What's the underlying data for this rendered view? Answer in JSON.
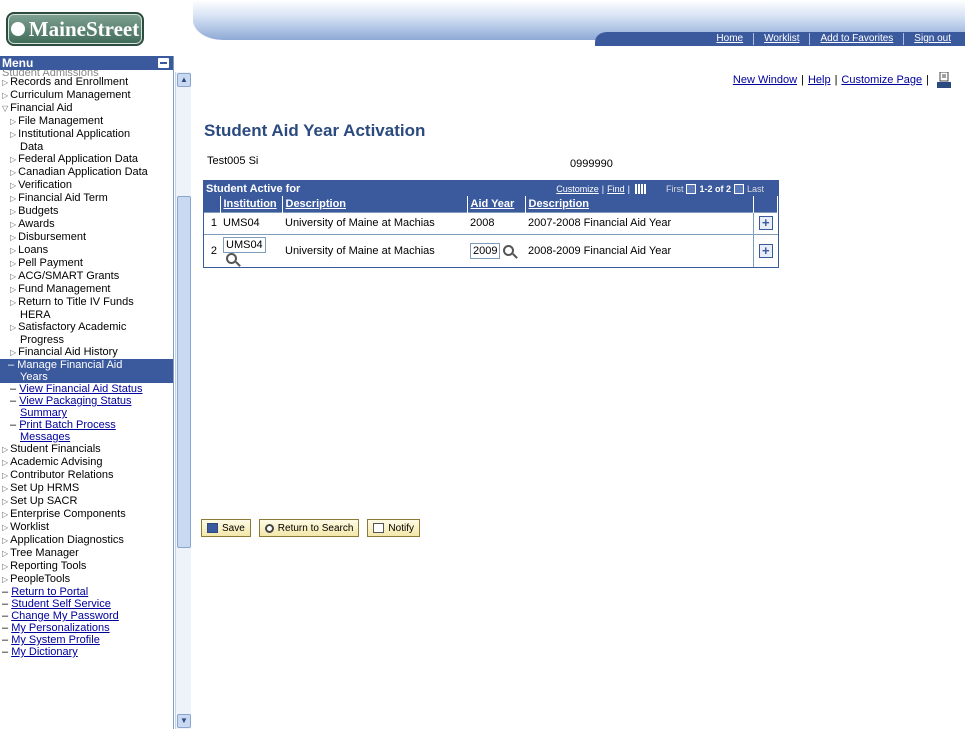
{
  "logo": {
    "text": "MaineStreet"
  },
  "top_nav": {
    "home": "Home",
    "worklist": "Worklist",
    "add_to_favorites": "Add to Favorites",
    "sign_out": "Sign out"
  },
  "menu": {
    "title": "Menu",
    "clipped_item": "Student Admissions",
    "items": [
      {
        "label": "Records and Enrollment"
      },
      {
        "label": "Curriculum Management"
      },
      {
        "label": "Financial Aid"
      },
      {
        "label": "File Management"
      },
      {
        "label": "Institutional Application"
      },
      {
        "label": "Data"
      },
      {
        "label": "Federal Application Data"
      },
      {
        "label": "Canadian Application Data"
      },
      {
        "label": "Verification"
      },
      {
        "label": "Financial Aid Term"
      },
      {
        "label": "Budgets"
      },
      {
        "label": "Awards"
      },
      {
        "label": "Disbursement"
      },
      {
        "label": "Loans"
      },
      {
        "label": "Pell Payment"
      },
      {
        "label": "ACG/SMART Grants"
      },
      {
        "label": "Fund Management"
      },
      {
        "label": "Return to Title IV Funds"
      },
      {
        "label": "HERA"
      },
      {
        "label": "Satisfactory Academic"
      },
      {
        "label": "Progress"
      },
      {
        "label": "Financial Aid History"
      },
      {
        "label": "Manage Financial Aid"
      },
      {
        "label": "Years"
      },
      {
        "label": "View Financial Aid Status"
      },
      {
        "label": "View Packaging Status"
      },
      {
        "label": "Summary"
      },
      {
        "label": "Print Batch Process"
      },
      {
        "label": "Messages"
      },
      {
        "label": "Student Financials"
      },
      {
        "label": "Academic Advising"
      },
      {
        "label": "Contributor Relations"
      },
      {
        "label": "Set Up HRMS"
      },
      {
        "label": "Set Up SACR"
      },
      {
        "label": "Enterprise Components"
      },
      {
        "label": "Worklist"
      },
      {
        "label": "Application Diagnostics"
      },
      {
        "label": "Tree Manager"
      },
      {
        "label": "Reporting Tools"
      },
      {
        "label": "PeopleTools"
      },
      {
        "label": "Return to Portal"
      },
      {
        "label": "Student Self Service"
      },
      {
        "label": "Change My Password"
      },
      {
        "label": "My Personalizations"
      },
      {
        "label": "My System Profile"
      },
      {
        "label": "My Dictionary"
      }
    ]
  },
  "page_links": {
    "new_window": "New Window",
    "help": "Help",
    "customize_page": "Customize Page"
  },
  "page": {
    "title": "Student Aid Year Activation",
    "student_name": "Test005 Si",
    "student_id": "0999990"
  },
  "grid": {
    "title": "Student Active for",
    "customize": "Customize",
    "find": "Find",
    "first": "First",
    "position": "1-2 of 2",
    "last": "Last",
    "columns": [
      "Institution",
      "Description",
      "Aid Year",
      "Description"
    ],
    "rows": [
      {
        "num": "1",
        "institution": "UMS04",
        "inst_desc": "University of Maine at Machias",
        "aid_year": "2008",
        "year_desc": "2007-2008 Financial Aid Year"
      },
      {
        "num": "2",
        "institution": "UMS04",
        "inst_desc": "University of Maine at Machias",
        "aid_year": "2009",
        "year_desc": "2008-2009 Financial Aid Year"
      }
    ]
  },
  "actions": {
    "save": "Save",
    "return_to_search": "Return to Search",
    "notify": "Notify"
  },
  "colors": {
    "brand_blue": "#3b5a9e",
    "title_blue": "#2b4a7f",
    "link_blue": "#00009c",
    "logo_green": "#3f6a58"
  }
}
